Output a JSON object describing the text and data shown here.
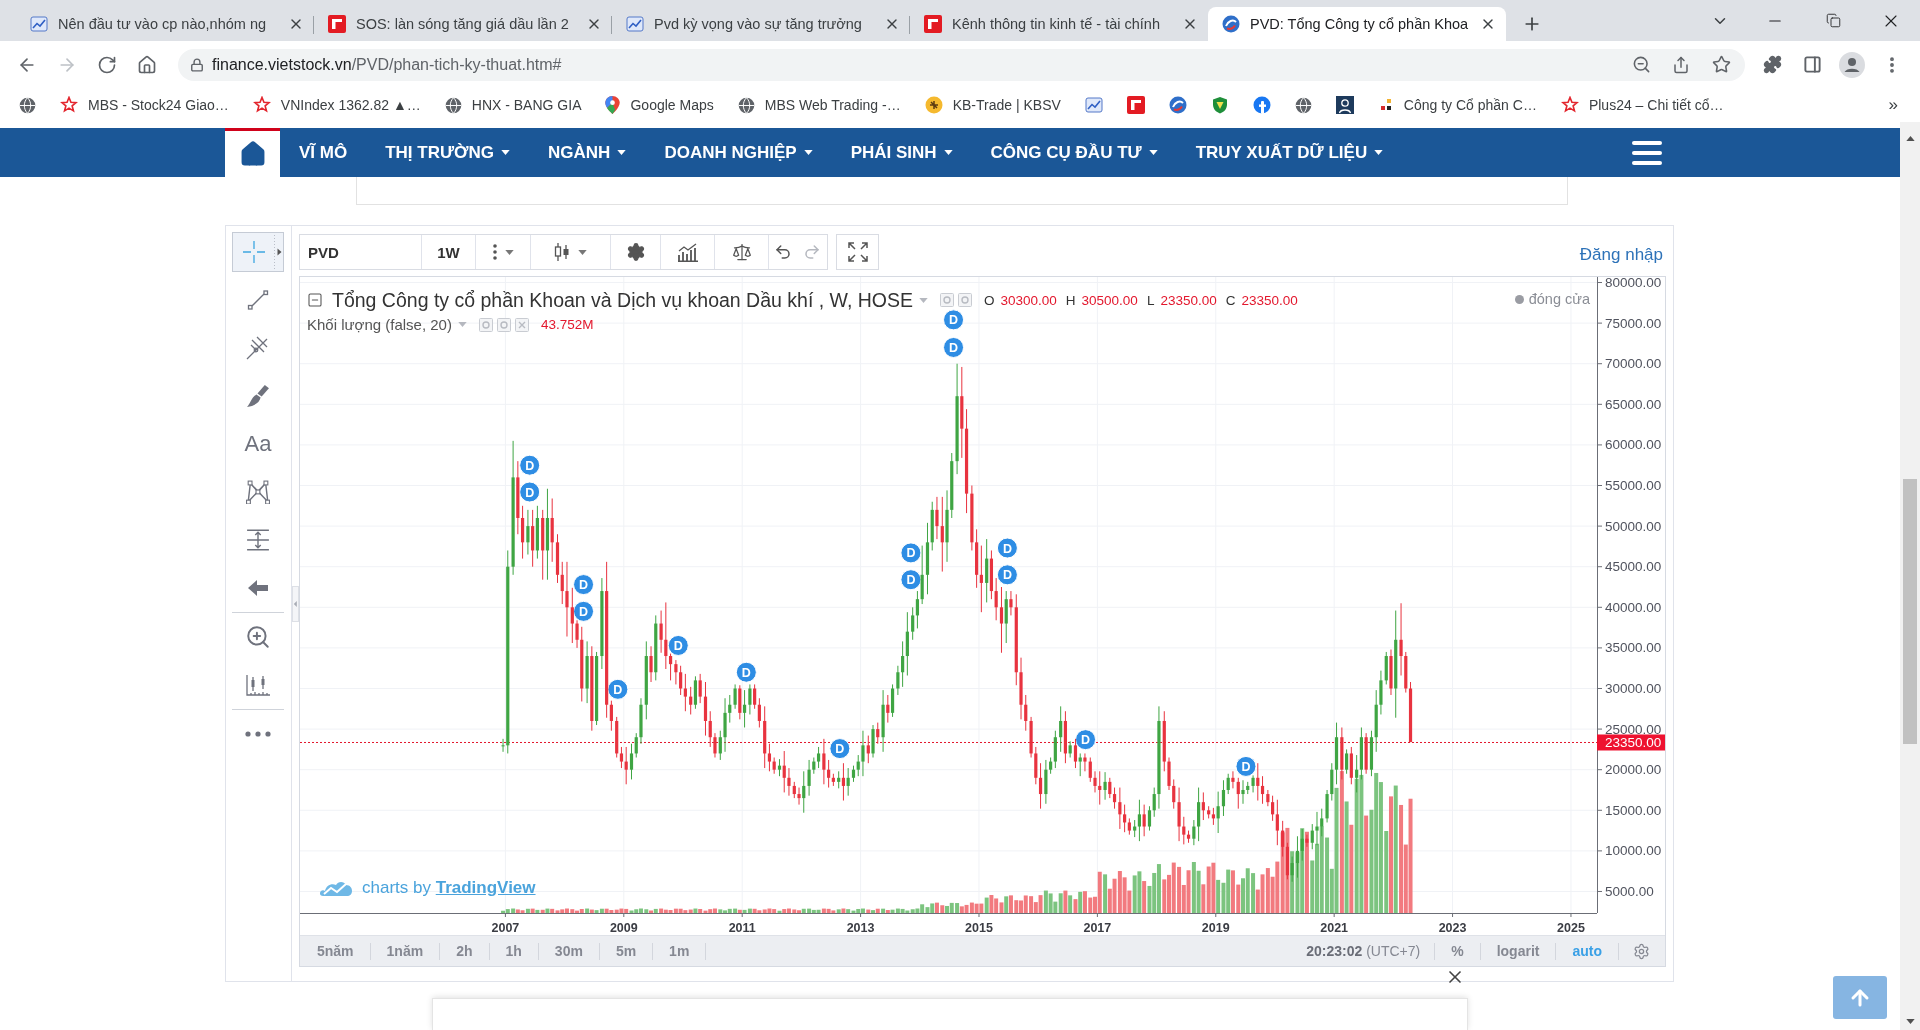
{
  "browser": {
    "tabs": [
      {
        "title": "Nên đầu tư vào cp nào,nhóm ng",
        "selected": false
      },
      {
        "title": "SOS: làn sóng tăng giá dầu lần 2",
        "selected": false
      },
      {
        "title": "Pvd kỳ vọng vào sự tăng trưởng",
        "selected": false
      },
      {
        "title": "Kênh thông tin kinh tế - tài chính",
        "selected": false
      },
      {
        "title": "PVD: Tổng Công ty cổ phần Khoa",
        "selected": true
      }
    ],
    "nav_buttons": [
      {
        "kind": "back",
        "disabled": false
      },
      {
        "kind": "forward",
        "disabled": true
      },
      {
        "kind": "reload",
        "disabled": false
      },
      {
        "kind": "home",
        "disabled": false
      }
    ],
    "address": {
      "domain": "finance.vietstock.vn",
      "path": "/PVD/phan-tich-ky-thuat.htm#"
    },
    "bookmarks": [
      {
        "kind": "icon"
      },
      {
        "kind": "link",
        "label": "MBS - Stock24 Giao…"
      },
      {
        "kind": "link",
        "label": "VNIndex 1362.82 ▲…"
      },
      {
        "kind": "link",
        "label": "HNX - BANG GIA"
      },
      {
        "kind": "link",
        "label": "Google Maps"
      },
      {
        "kind": "link",
        "label": "MBS Web Trading -…"
      },
      {
        "kind": "link",
        "label": "KB-Trade | KBSV"
      },
      {
        "kind": "icon"
      },
      {
        "kind": "icon"
      },
      {
        "kind": "icon"
      },
      {
        "kind": "icon"
      },
      {
        "kind": "icon"
      },
      {
        "kind": "icon"
      },
      {
        "kind": "icon"
      },
      {
        "kind": "link",
        "label": "Công ty Cổ phần C…"
      },
      {
        "kind": "link",
        "label": "Plus24 – Chi tiết cổ…"
      }
    ],
    "bookmarks_more": "»"
  },
  "site_nav": {
    "items": [
      {
        "label": "VĨ MÔ",
        "dropdown": false
      },
      {
        "label": "THỊ TRƯỜNG",
        "dropdown": true
      },
      {
        "label": "NGÀNH",
        "dropdown": true
      },
      {
        "label": "DOANH NGHIỆP",
        "dropdown": true
      },
      {
        "label": "PHÁI SINH",
        "dropdown": true
      },
      {
        "label": "CÔNG CỤ ĐẦU TƯ",
        "dropdown": true
      },
      {
        "label": "TRUY XUẤT DỮ LIỆU",
        "dropdown": true
      }
    ]
  },
  "chart_widget": {
    "tool_groups": [
      {
        "tools": [
          {
            "kind": "crosshair",
            "selected": true
          },
          {
            "kind": "trend-line",
            "selected": false
          },
          {
            "kind": "pitchfork",
            "selected": false
          },
          {
            "kind": "brush",
            "selected": false
          },
          {
            "kind": "text",
            "label": "Aa",
            "selected": false
          },
          {
            "kind": "pattern",
            "selected": false
          },
          {
            "kind": "measure",
            "selected": false
          },
          {
            "kind": "arrow",
            "selected": false
          }
        ]
      },
      {
        "tools": [
          {
            "kind": "zoom",
            "selected": false
          },
          {
            "kind": "ruler",
            "selected": false
          }
        ]
      },
      {
        "tools": [
          {
            "kind": "more",
            "selected": false
          }
        ]
      }
    ],
    "toolbar": {
      "symbol": "PVD",
      "interval": "1W"
    },
    "login": "Đăng nhập",
    "legend": {
      "ohlc": [
        {
          "key": "O",
          "value": "30300.00"
        },
        {
          "key": "H",
          "value": "30500.00"
        },
        {
          "key": "L",
          "value": "23350.00"
        },
        {
          "key": "C",
          "value": "23350.00"
        }
      ],
      "status": "đóng cửa"
    },
    "volume_legend": {
      "title": "Khối lượng (false, 20)",
      "value": "43.752M"
    },
    "chart_data": {
      "type": "candlestick",
      "title": "Tổng Công ty cổ phần Khoan và Dịch vụ khoan Dầu khí , W, HOSE",
      "x": [
        2006.96,
        2007.04,
        2007.13,
        2007.21,
        2007.29,
        2007.38,
        2007.46,
        2007.54,
        2007.63,
        2007.71,
        2007.79,
        2007.88,
        2007.96,
        2008.04,
        2008.13,
        2008.21,
        2008.29,
        2008.38,
        2008.46,
        2008.54,
        2008.63,
        2008.71,
        2008.79,
        2008.88,
        2008.96,
        2009.04,
        2009.13,
        2009.21,
        2009.29,
        2009.38,
        2009.46,
        2009.54,
        2009.63,
        2009.71,
        2009.79,
        2009.88,
        2009.96,
        2010.04,
        2010.13,
        2010.21,
        2010.29,
        2010.38,
        2010.46,
        2010.54,
        2010.63,
        2010.71,
        2010.79,
        2010.88,
        2010.96,
        2011.04,
        2011.13,
        2011.21,
        2011.29,
        2011.38,
        2011.46,
        2011.54,
        2011.63,
        2011.71,
        2011.79,
        2011.88,
        2011.96,
        2012.04,
        2012.13,
        2012.21,
        2012.29,
        2012.38,
        2012.46,
        2012.54,
        2012.63,
        2012.71,
        2012.79,
        2012.88,
        2012.96,
        2013.04,
        2013.13,
        2013.21,
        2013.29,
        2013.38,
        2013.46,
        2013.54,
        2013.63,
        2013.71,
        2013.79,
        2013.88,
        2013.96,
        2014.04,
        2014.13,
        2014.21,
        2014.29,
        2014.38,
        2014.46,
        2014.54,
        2014.63,
        2014.71,
        2014.79,
        2014.88,
        2014.96,
        2015.04,
        2015.13,
        2015.21,
        2015.29,
        2015.38,
        2015.46,
        2015.54,
        2015.63,
        2015.71,
        2015.79,
        2015.88,
        2015.96,
        2016.04,
        2016.13,
        2016.21,
        2016.29,
        2016.38,
        2016.46,
        2016.54,
        2016.63,
        2016.71,
        2016.79,
        2016.88,
        2016.96,
        2017.04,
        2017.13,
        2017.21,
        2017.29,
        2017.38,
        2017.46,
        2017.54,
        2017.63,
        2017.71,
        2017.79,
        2017.88,
        2017.96,
        2018.04,
        2018.13,
        2018.21,
        2018.29,
        2018.38,
        2018.46,
        2018.54,
        2018.63,
        2018.71,
        2018.79,
        2018.88,
        2018.96,
        2019.04,
        2019.13,
        2019.21,
        2019.29,
        2019.38,
        2019.46,
        2019.54,
        2019.63,
        2019.71,
        2019.79,
        2019.88,
        2019.96,
        2020.04,
        2020.13,
        2020.21,
        2020.29,
        2020.38,
        2020.46,
        2020.54,
        2020.63,
        2020.71,
        2020.79,
        2020.88,
        2020.96,
        2021.04,
        2021.13,
        2021.21,
        2021.29,
        2021.38,
        2021.46,
        2021.54,
        2021.63,
        2021.71,
        2021.79,
        2021.88,
        2021.96,
        2022.04,
        2022.13,
        2022.21,
        2022.29
      ],
      "ohlc": [
        [
          23000,
          23800,
          22200,
          23000
        ],
        [
          23000,
          47000,
          22000,
          45000
        ],
        [
          45000,
          60500,
          44000,
          56000
        ],
        [
          56000,
          58000,
          49000,
          51000
        ],
        [
          51000,
          52500,
          46000,
          48000
        ],
        [
          48000,
          52000,
          46500,
          50000
        ],
        [
          50000,
          52000,
          45000,
          47000
        ],
        [
          47000,
          52500,
          46000,
          51000
        ],
        [
          51000,
          52000,
          43400,
          47000
        ],
        [
          47000,
          54600,
          43400,
          51000
        ],
        [
          51000,
          53400,
          45600,
          48000
        ],
        [
          48000,
          49000,
          43000,
          44000
        ],
        [
          44000,
          45600,
          40400,
          42000
        ],
        [
          42000,
          45600,
          36400,
          40000
        ],
        [
          40000,
          42400,
          35600,
          38000
        ],
        [
          38000,
          38400,
          35000,
          36000
        ],
        [
          36000,
          37600,
          28400,
          30000
        ],
        [
          30000,
          35800,
          28200,
          34000
        ],
        [
          34000,
          35200,
          24800,
          26000
        ],
        [
          26000,
          34500,
          25500,
          34000
        ],
        [
          34000,
          43600,
          32400,
          42000
        ],
        [
          42000,
          45600,
          26400,
          28000
        ],
        [
          28000,
          28500,
          24800,
          26000
        ],
        [
          26000,
          26500,
          21500,
          22000
        ],
        [
          22000,
          22800,
          20200,
          21000
        ],
        [
          21000,
          22800,
          18200,
          20000
        ],
        [
          20000,
          23200,
          18800,
          22000
        ],
        [
          22000,
          24500,
          21500,
          24000
        ],
        [
          24000,
          28800,
          23200,
          28000
        ],
        [
          28000,
          35800,
          26200,
          34000
        ],
        [
          34000,
          35200,
          30800,
          32000
        ],
        [
          32000,
          39000,
          31000,
          38000
        ],
        [
          38000,
          39600,
          34400,
          36000
        ],
        [
          36000,
          40600,
          32400,
          34000
        ],
        [
          34000,
          34300,
          31000,
          33000
        ],
        [
          33000,
          33500,
          30500,
          32000
        ],
        [
          32000,
          32800,
          29200,
          30000
        ],
        [
          30000,
          31800,
          27200,
          29000
        ],
        [
          29000,
          30200,
          26800,
          28000
        ],
        [
          28000,
          31500,
          27500,
          31000
        ],
        [
          31000,
          31800,
          28200,
          29000
        ],
        [
          29000,
          30800,
          24200,
          26000
        ],
        [
          26000,
          27200,
          22800,
          24000
        ],
        [
          24000,
          24500,
          21500,
          22000
        ],
        [
          22000,
          24800,
          21200,
          24000
        ],
        [
          24000,
          28800,
          22200,
          27000
        ],
        [
          27000,
          29200,
          25800,
          28000
        ],
        [
          28000,
          30500,
          27500,
          30000
        ],
        [
          30000,
          30400,
          26200,
          27000
        ],
        [
          27000,
          29800,
          25200,
          28000
        ],
        [
          28000,
          30500,
          26800,
          30000
        ],
        [
          30000,
          30500,
          27500,
          28000
        ],
        [
          28000,
          28800,
          25200,
          26000
        ],
        [
          26000,
          27800,
          20200,
          22000
        ],
        [
          22000,
          23200,
          19800,
          21000
        ],
        [
          21000,
          21500,
          19500,
          20000
        ],
        [
          20000,
          21300,
          19200,
          20500
        ],
        [
          20500,
          22300,
          17200,
          19000
        ],
        [
          19000,
          20200,
          16800,
          18000
        ],
        [
          18000,
          18500,
          16500,
          17000
        ],
        [
          17000,
          17800,
          15700,
          16500
        ],
        [
          16500,
          19800,
          14700,
          18000
        ],
        [
          18000,
          21200,
          16800,
          20000
        ],
        [
          20000,
          21500,
          19500,
          21000
        ],
        [
          21000,
          22800,
          20200,
          22000
        ],
        [
          22000,
          23800,
          18200,
          20000
        ],
        [
          20000,
          21200,
          17800,
          19000
        ],
        [
          19000,
          19500,
          18000,
          18500
        ],
        [
          18500,
          19800,
          17700,
          19000
        ],
        [
          19000,
          20800,
          16200,
          18000
        ],
        [
          18000,
          20200,
          16800,
          19000
        ],
        [
          19000,
          20500,
          18500,
          20000
        ],
        [
          20000,
          21800,
          19200,
          21000
        ],
        [
          21000,
          24800,
          19200,
          23000
        ],
        [
          23000,
          24200,
          20800,
          22000
        ],
        [
          22000,
          25500,
          21500,
          25000
        ],
        [
          25000,
          25800,
          23200,
          24000
        ],
        [
          24000,
          29800,
          22200,
          28000
        ],
        [
          28000,
          29200,
          25800,
          27000
        ],
        [
          27000,
          30500,
          26500,
          30000
        ],
        [
          30000,
          32800,
          29200,
          32000
        ],
        [
          32000,
          35800,
          30200,
          34000
        ],
        [
          34000,
          39400,
          31600,
          37000
        ],
        [
          37000,
          40000,
          36000,
          39000
        ],
        [
          39000,
          42000,
          37400,
          41000
        ],
        [
          41000,
          47600,
          40400,
          44000
        ],
        [
          44000,
          50400,
          41600,
          48000
        ],
        [
          48000,
          53000,
          47000,
          52000
        ],
        [
          52000,
          53600,
          48400,
          50000
        ],
        [
          50000,
          53600,
          44400,
          48000
        ],
        [
          48000,
          54400,
          45600,
          52000
        ],
        [
          52000,
          59000,
          51000,
          58000
        ],
        [
          58000,
          70000,
          56400,
          66000
        ],
        [
          66000,
          69600,
          58400,
          62000
        ],
        [
          62000,
          64400,
          51600,
          54000
        ],
        [
          54000,
          55000,
          47000,
          48000
        ],
        [
          48000,
          49600,
          42400,
          44000
        ],
        [
          44000,
          47600,
          39400,
          43000
        ],
        [
          43000,
          48400,
          40600,
          46000
        ],
        [
          46000,
          47000,
          41000,
          42000
        ],
        [
          42000,
          43600,
          38400,
          40000
        ],
        [
          40000,
          42500,
          34400,
          38000
        ],
        [
          38000,
          42000,
          35600,
          41000
        ],
        [
          41000,
          42000,
          39000,
          40000
        ],
        [
          40000,
          41600,
          30400,
          32000
        ],
        [
          32000,
          33800,
          26200,
          28000
        ],
        [
          28000,
          29200,
          24800,
          26000
        ],
        [
          26000,
          26500,
          21500,
          22000
        ],
        [
          22000,
          22800,
          18200,
          19000
        ],
        [
          19000,
          20800,
          15200,
          17000
        ],
        [
          17000,
          21200,
          15800,
          20000
        ],
        [
          20000,
          21500,
          19500,
          21000
        ],
        [
          21000,
          24800,
          20200,
          24000
        ],
        [
          24000,
          27800,
          22200,
          26000
        ],
        [
          26000,
          27200,
          20800,
          22000
        ],
        [
          22000,
          23500,
          21500,
          23000
        ],
        [
          23000,
          23800,
          20200,
          21000
        ],
        [
          21000,
          22000,
          19200,
          21500
        ],
        [
          21500,
          22000,
          19800,
          21000
        ],
        [
          21000,
          21500,
          18500,
          19000
        ],
        [
          19000,
          19800,
          17200,
          18000
        ],
        [
          18000,
          19800,
          15700,
          17500
        ],
        [
          17500,
          19700,
          16300,
          18500
        ],
        [
          18500,
          19000,
          16500,
          17000
        ],
        [
          17000,
          17800,
          15200,
          16000
        ],
        [
          16000,
          17800,
          12700,
          14500
        ],
        [
          14500,
          15700,
          12300,
          13500
        ],
        [
          13500,
          14000,
          12000,
          12500
        ],
        [
          12500,
          13800,
          11700,
          13000
        ],
        [
          13000,
          16300,
          11200,
          14500
        ],
        [
          14500,
          15700,
          11800,
          13000
        ],
        [
          13000,
          15500,
          12500,
          15000
        ],
        [
          15000,
          17800,
          14200,
          17000
        ],
        [
          17000,
          27800,
          15200,
          26000
        ],
        [
          26000,
          27200,
          19800,
          21000
        ],
        [
          21000,
          21500,
          17500,
          18000
        ],
        [
          18000,
          18800,
          15200,
          16000
        ],
        [
          16000,
          17800,
          11200,
          13000
        ],
        [
          13000,
          14200,
          10800,
          12000
        ],
        [
          12000,
          12500,
          11000,
          11500
        ],
        [
          11500,
          13800,
          10700,
          13000
        ],
        [
          13000,
          17800,
          11200,
          16000
        ],
        [
          16000,
          17200,
          13800,
          15000
        ],
        [
          15000,
          15500,
          14000,
          14500
        ],
        [
          14500,
          15300,
          13200,
          14000
        ],
        [
          14000,
          17300,
          12200,
          15500
        ],
        [
          15500,
          18700,
          14300,
          17500
        ],
        [
          17500,
          19500,
          17000,
          19000
        ],
        [
          19000,
          19800,
          17700,
          18500
        ],
        [
          18500,
          19000,
          15200,
          17000
        ],
        [
          17000,
          18700,
          15800,
          17500
        ],
        [
          17500,
          18500,
          17000,
          18000
        ],
        [
          18000,
          19300,
          17200,
          19000
        ],
        [
          19000,
          20800,
          16200,
          18000
        ],
        [
          18000,
          19200,
          15800,
          17000
        ],
        [
          17000,
          17500,
          15500,
          16000
        ],
        [
          16000,
          16800,
          13700,
          14500
        ],
        [
          14500,
          16300,
          10700,
          12500
        ],
        [
          12500,
          13700,
          9300,
          10500
        ],
        [
          10500,
          11000,
          6500,
          7000
        ],
        [
          7000,
          9300,
          6200,
          8500
        ],
        [
          8500,
          11800,
          6700,
          10000
        ],
        [
          10000,
          12700,
          8800,
          11500
        ],
        [
          11500,
          12000,
          10500,
          11000
        ],
        [
          11000,
          13300,
          10200,
          12500
        ],
        [
          12500,
          14800,
          10700,
          13000
        ],
        [
          13000,
          15200,
          11800,
          14000
        ],
        [
          14000,
          17500,
          13500,
          17000
        ],
        [
          17000,
          20800,
          16200,
          20000
        ],
        [
          20000,
          25800,
          18200,
          24000
        ],
        [
          24000,
          25200,
          18800,
          20000
        ],
        [
          20000,
          22500,
          19500,
          22000
        ],
        [
          22000,
          22800,
          18200,
          19000
        ],
        [
          19000,
          21800,
          17200,
          20000
        ],
        [
          20000,
          25200,
          18800,
          24000
        ],
        [
          24000,
          24500,
          19500,
          20000
        ],
        [
          20000,
          24800,
          19200,
          24000
        ],
        [
          24000,
          29800,
          22200,
          28000
        ],
        [
          28000,
          32200,
          26800,
          31000
        ],
        [
          31000,
          34500,
          30500,
          34000
        ],
        [
          34000,
          34800,
          29200,
          30000
        ],
        [
          30000,
          39600,
          26400,
          36000
        ],
        [
          36000,
          40500,
          31600,
          34000
        ],
        [
          34000,
          34500,
          29500,
          30000
        ],
        [
          30000,
          30800,
          23400,
          23400
        ]
      ],
      "xlim": [
        2003.53,
        2025.44
      ],
      "ylim": [
        2350,
        80680
      ],
      "grid": true,
      "xticks": [
        2007,
        2009,
        2011,
        2013,
        2015,
        2017,
        2019,
        2021,
        2023,
        2025
      ],
      "yticks": [
        {
          "value": 5000,
          "label": "5000.00"
        },
        {
          "value": 10000,
          "label": "10000.00"
        },
        {
          "value": 15000,
          "label": "15000.00"
        },
        {
          "value": 20000,
          "label": "20000.00"
        },
        {
          "value": 25000,
          "label": "25000.00"
        },
        {
          "value": 30000,
          "label": "30000.00"
        },
        {
          "value": 35000,
          "label": "35000.00"
        },
        {
          "value": 40000,
          "label": "40000.00"
        },
        {
          "value": 45000,
          "label": "45000.00"
        },
        {
          "value": 50000,
          "label": "50000.00"
        },
        {
          "value": 55000,
          "label": "55000.00"
        },
        {
          "value": 60000,
          "label": "60000.00"
        },
        {
          "value": 65000,
          "label": "65000.00"
        },
        {
          "value": 70000,
          "label": "70000.00"
        },
        {
          "value": 75000,
          "label": "75000.00"
        },
        {
          "value": 80000,
          "label": "80000.00"
        }
      ],
      "ref_lines": [
        {
          "axis": "y",
          "value": 23350,
          "label": "23350.00"
        }
      ],
      "annotations": [
        {
          "x": 2007.41,
          "y": 57500,
          "text": "D"
        },
        {
          "x": 2007.41,
          "y": 54200,
          "text": "D"
        },
        {
          "x": 2008.32,
          "y": 42800,
          "text": "D"
        },
        {
          "x": 2008.32,
          "y": 39500,
          "text": "D"
        },
        {
          "x": 2008.9,
          "y": 29900,
          "text": "D"
        },
        {
          "x": 2009.92,
          "y": 35300,
          "text": "D"
        },
        {
          "x": 2011.07,
          "y": 32000,
          "text": "D"
        },
        {
          "x": 2012.65,
          "y": 22600,
          "text": "D"
        },
        {
          "x": 2013.85,
          "y": 46700,
          "text": "D"
        },
        {
          "x": 2013.85,
          "y": 43400,
          "text": "D"
        },
        {
          "x": 2014.57,
          "y": 75400,
          "text": "D"
        },
        {
          "x": 2014.57,
          "y": 72000,
          "text": "D"
        },
        {
          "x": 2015.48,
          "y": 47300,
          "text": "D"
        },
        {
          "x": 2015.48,
          "y": 44000,
          "text": "D"
        },
        {
          "x": 2016.8,
          "y": 23700,
          "text": "D"
        },
        {
          "x": 2019.51,
          "y": 20400,
          "text": "D"
        }
      ]
    },
    "attribution": {
      "text": "charts by",
      "link": "TradingView"
    },
    "ranges": [
      "5năm",
      "1năm",
      "2h",
      "1h",
      "30m",
      "5m",
      "1m"
    ],
    "clock": "**20:23:02** (UTC+7)",
    "scale_options": [
      {
        "label": "%",
        "on": false
      },
      {
        "label": "logarit",
        "on": false
      },
      {
        "label": "auto",
        "on": true
      }
    ]
  }
}
